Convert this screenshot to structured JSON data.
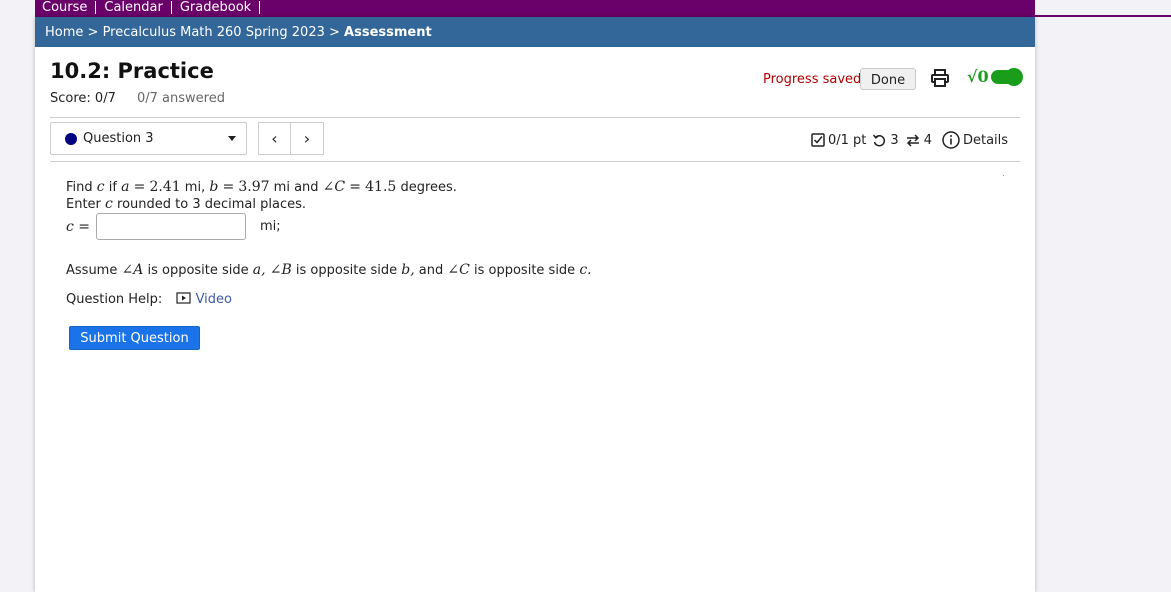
{
  "topnav": {
    "items": [
      "Course",
      "Calendar",
      "Gradebook"
    ]
  },
  "breadcrumb": {
    "home": "Home",
    "sep": " > ",
    "course": "Precalculus Math 260 Spring 2023",
    "current": "Assessment"
  },
  "assessment": {
    "title": "10.2: Practice",
    "score": "Score: 0/7",
    "answered": "0/7 answered"
  },
  "header": {
    "progress_saved": "Progress saved",
    "done_label": "Done",
    "sqrt_label": "√0"
  },
  "question_nav": {
    "selected": "Question 3",
    "prev": "‹",
    "next": "›"
  },
  "question_info": {
    "points": "0/1 pt",
    "retries": "3",
    "attempts": "4",
    "details": "Details"
  },
  "question": {
    "find": "Find",
    "var_c": "c",
    "if": "if",
    "a": "a",
    "eq": "=",
    "a_val": "2.41",
    "unit": "mi,",
    "b": "b",
    "b_val": "3.97",
    "and_C": "mi and",
    "angle_C": "∠C",
    "C_val": "41.5",
    "degrees": "degrees.",
    "enter_prefix": "Enter",
    "enter_suffix": "rounded to 3 decimal places.",
    "c_eq": "c =",
    "input_value": "",
    "mi_suffix": "mi;",
    "assume_1": "Assume",
    "angle_A": "∠A",
    "opp": "is opposite side",
    "side_a": "a,",
    "angle_B": "∠B",
    "side_b": "b,",
    "and": "and",
    "angle_C2": "∠C",
    "side_c": "c.",
    "help_label": "Question Help:",
    "video_label": "Video",
    "submit_label": "Submit Question"
  }
}
